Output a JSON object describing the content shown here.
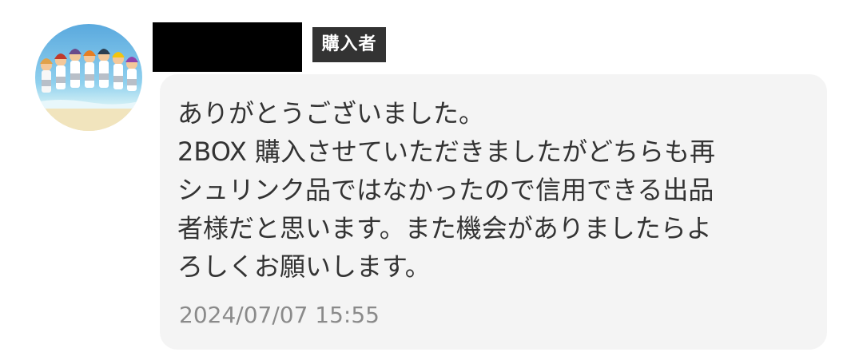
{
  "sender": {
    "avatar_icon": "anime-group-beach-avatar-icon",
    "name_redacted": true,
    "badge_label": "購入者"
  },
  "message": {
    "text": "ありがとうございました。\n2BOX 購入させていただきましたがどちらも再\nシュリンク品ではなかったので信用できる出品\n者様だと思います。また機会がありましたらよ\nろしくお願いします。",
    "timestamp": "2024/07/07 15:55"
  },
  "colors": {
    "badge_bg": "#333333",
    "bubble_bg": "#f4f4f4",
    "text": "#333333",
    "timestamp": "#8a8a8a"
  }
}
